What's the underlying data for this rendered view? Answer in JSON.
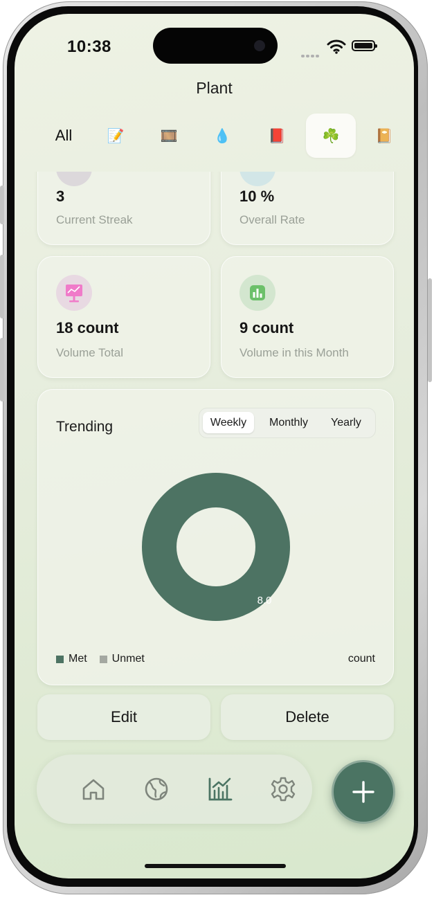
{
  "status_bar": {
    "time": "10:38"
  },
  "header": {
    "title": "Plant"
  },
  "categories": [
    {
      "label": "All",
      "type": "text"
    },
    {
      "label": "📝",
      "type": "emoji"
    },
    {
      "label": "🎞️",
      "type": "emoji"
    },
    {
      "label": "💧",
      "type": "emoji"
    },
    {
      "label": "📕",
      "type": "emoji"
    },
    {
      "label": "☘️",
      "type": "emoji",
      "selected": true
    },
    {
      "label": "📔",
      "type": "emoji"
    }
  ],
  "stats": [
    {
      "value": "3",
      "label": "Current Streak",
      "icon": "streak-icon"
    },
    {
      "value": "10 %",
      "label": "Overall Rate",
      "icon": "rate-icon"
    },
    {
      "value": "18 count",
      "label": "Volume Total",
      "icon": "monitor-chart-icon"
    },
    {
      "value": "9 count",
      "label": "Volume in this Month",
      "icon": "bar-chart-icon"
    }
  ],
  "trending": {
    "title": "Trending",
    "periods": [
      "Weekly",
      "Monthly",
      "Yearly"
    ],
    "selected_period": "Weekly",
    "unit": "count"
  },
  "chart_data": {
    "type": "pie",
    "labels": [
      "Met",
      "Unmet"
    ],
    "values": [
      8.0,
      0
    ],
    "data_labels": [
      "8.0",
      ""
    ],
    "colors": [
      "#4d7363",
      "#a4a8a1"
    ]
  },
  "actions": {
    "edit": "Edit",
    "delete": "Delete"
  },
  "tabbar": {
    "items": [
      "home-icon",
      "globe-icon",
      "statistics-icon",
      "settings-icon"
    ],
    "active": "statistics-icon"
  },
  "fab": {
    "icon": "plus-icon"
  },
  "colors": {
    "accent": "#4b7463",
    "met": "#4d7363",
    "unmet": "#a4a8a1"
  }
}
